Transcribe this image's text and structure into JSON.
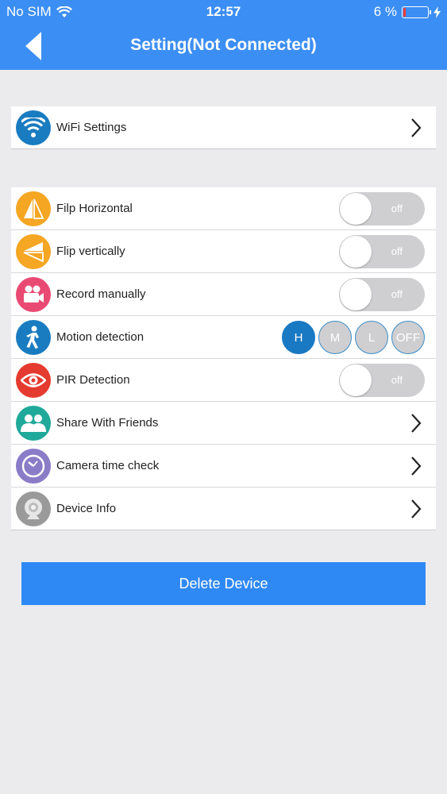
{
  "status": {
    "carrier": "No SIM",
    "time": "12:57",
    "battery_text": "6 %",
    "battery_level": 0.06
  },
  "nav": {
    "title": "Setting(Not Connected)"
  },
  "wifi": {
    "label": "WiFi Settings"
  },
  "settings": {
    "flip_horizontal": {
      "label": "Filp Horizontal",
      "state": "off"
    },
    "flip_vertical": {
      "label": "Flip vertically",
      "state": "off"
    },
    "record_manually": {
      "label": "Record manually",
      "state": "off"
    },
    "motion_detection": {
      "label": "Motion detection",
      "levels": [
        "H",
        "M",
        "L",
        "OFF"
      ],
      "selected": "H"
    },
    "pir_detection": {
      "label": "PIR Detection",
      "state": "off"
    },
    "share": {
      "label": "Share With Friends"
    },
    "time_check": {
      "label": "Camera time check"
    },
    "device_info": {
      "label": "Device Info"
    }
  },
  "delete_button": "Delete Device",
  "colors": {
    "accent": "#3b8ef3",
    "button": "#2f89f4",
    "wifi": "#1a7cc0",
    "flip": "#f5a623",
    "record": "#e94a73",
    "motion": "#1a7cc0",
    "pir": "#e53a2f",
    "share": "#1fa99a",
    "time": "#8b7cc8",
    "info": "#9a9a9a"
  }
}
